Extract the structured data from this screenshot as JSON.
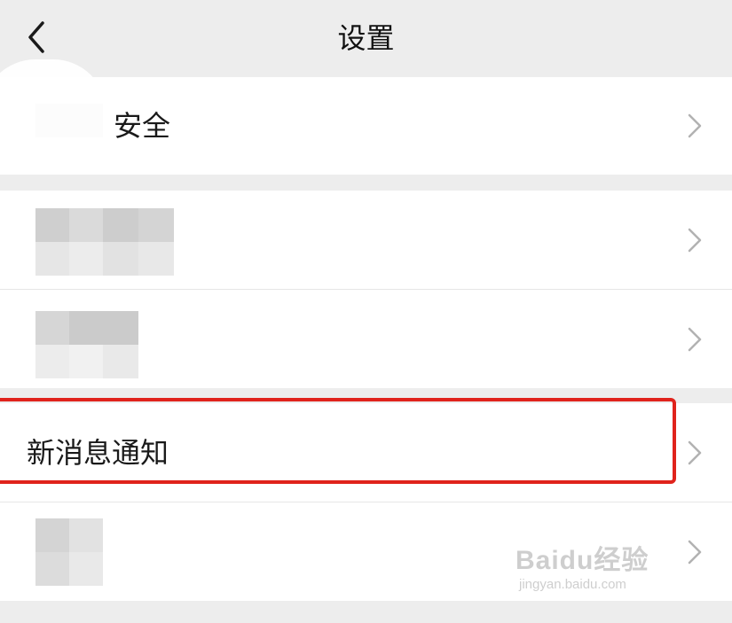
{
  "header": {
    "title": "设置",
    "back_icon": "chevron-left-icon"
  },
  "rows": [
    {
      "label": "安全",
      "label_partially_obscured": true,
      "icon": "chevron-right-icon"
    },
    {
      "label": "",
      "obscured": true,
      "icon": "chevron-right-icon"
    },
    {
      "label": "",
      "obscured": true,
      "icon": "chevron-right-icon"
    },
    {
      "label": "新消息通知",
      "highlighted": true,
      "icon": "chevron-right-icon"
    },
    {
      "label": "",
      "obscured": true,
      "icon": "chevron-right-icon"
    }
  ],
  "watermark": {
    "main": "Baidu经验",
    "sub": "jingyan.baidu.com"
  },
  "colors": {
    "background": "#ededed",
    "row_background": "#ffffff",
    "highlight_border": "#e0231c",
    "chevron": "#b2b2b2"
  }
}
